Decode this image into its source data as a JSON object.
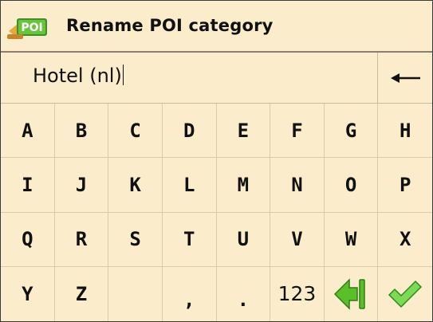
{
  "header": {
    "title": "Rename POI category",
    "icon": "poi-icon",
    "icon_label": "POI"
  },
  "input": {
    "value": "Hotel (nl)",
    "backspace_icon": "arrow-left-icon"
  },
  "keyboard": {
    "row1": [
      "A",
      "B",
      "C",
      "D",
      "E",
      "F",
      "G",
      "H"
    ],
    "row2": [
      "I",
      "J",
      "K",
      "L",
      "M",
      "N",
      "O",
      "P"
    ],
    "row3": [
      "Q",
      "R",
      "S",
      "T",
      "U",
      "V",
      "W",
      "X"
    ],
    "row4": [
      "Y",
      "Z",
      "",
      ",",
      ".",
      "123"
    ],
    "delete_icon": "green-arrow-left-icon",
    "confirm_icon": "green-checkmark-icon"
  },
  "colors": {
    "background": "#fbeccb",
    "accent_green": "#5bbf2a"
  }
}
